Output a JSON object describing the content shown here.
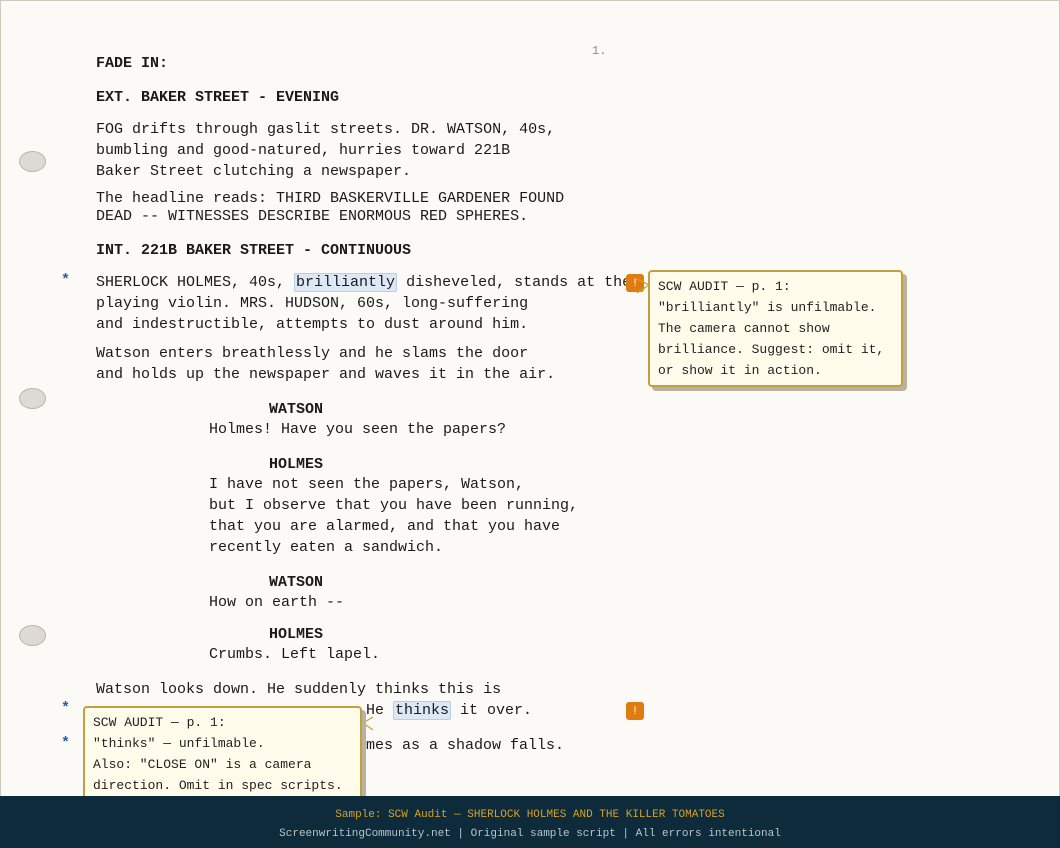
{
  "page": {
    "number": "1."
  },
  "script": {
    "fade_in": "FADE IN:",
    "slug1": "EXT. BAKER STREET - EVENING",
    "action1": [
      "FOG drifts through gaslit streets. DR. WATSON, 40s,",
      "bumbling and good-natured, hurries toward 221B",
      "Baker Street clutching a newspaper."
    ],
    "action2": [
      "The headline reads: THIRD BASKERVILLE GARDENER FOUND",
      "DEAD -- WITNESSES DESCRIBE ENORMOUS RED SPHERES."
    ],
    "slug2": "INT. 221B BAKER STREET - CONTINUOUS",
    "action3_pre": "SHERLOCK HOLMES, 40s, ",
    "action3_hl": "brilliantly",
    "action3_post": " disheveled, stands at the",
    "action3_rest": [
      "playing violin. MRS. HUDSON, 60s, long-suffering",
      "and indestructible, attempts to dust around him."
    ],
    "action4": [
      "Watson enters breathlessly and he slams the door",
      "and holds up the newspaper and waves it in the air."
    ],
    "dialogue": [
      {
        "character": "WATSON",
        "lines": [
          "Holmes! Have you seen the papers?"
        ]
      },
      {
        "character": "HOLMES",
        "lines": [
          "I have not seen the papers, Watson,",
          "but I observe that you have been running,",
          "that you are alarmed, and that you have",
          "recently eaten a sandwich."
        ]
      },
      {
        "character": "WATSON",
        "lines": [
          "How on earth --"
        ]
      },
      {
        "character": "HOLMES",
        "lines": [
          "Crumbs. Left lapel."
        ]
      }
    ],
    "action5_line1": "Watson looks down. He suddenly thinks this is",
    "action5_line2_pre": "He ",
    "action5_line2_hl": "thinks",
    "action5_line2_post": " it over.",
    "action5_line3_tail": "mes as a shadow falls.",
    "revision_mark": "*"
  },
  "audit_notes": [
    {
      "lines": [
        "SCW AUDIT — p. 1:",
        "\"brilliantly\" is unfilmable.",
        "The camera cannot show",
        "brilliance. Suggest: omit it,",
        "or show it in action."
      ]
    },
    {
      "lines": [
        "SCW AUDIT — p. 1:",
        "\"thinks\" — unfilmable.",
        "Also: \"CLOSE ON\" is a camera",
        "direction. Omit in spec scripts."
      ]
    }
  ],
  "badge_label": "!",
  "footer": {
    "line1": "Sample: SCW Audit  —  SHERLOCK HOLMES AND THE KILLER TOMATOES",
    "line2": "ScreenwritingCommunity.net  |  Original sample script  |  All errors intentional"
  },
  "colors": {
    "accent": "#e07b12",
    "note_border": "#c2a03e",
    "footer_bg": "#0d2b3a",
    "highlight": "#dde8f7"
  }
}
